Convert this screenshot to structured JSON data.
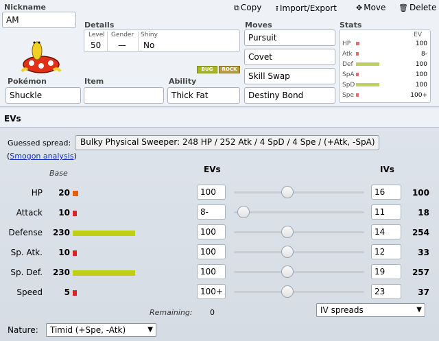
{
  "header": {
    "nickname_label": "Nickname",
    "nickname": "AM",
    "actions": [
      {
        "label": "Copy",
        "icon": "⧉"
      },
      {
        "label": "Import/Export",
        "icon": "⭱"
      },
      {
        "label": "Move",
        "icon": "✥"
      },
      {
        "label": "Delete",
        "icon": "🗑"
      }
    ]
  },
  "details": {
    "label": "Details",
    "level_label": "Level",
    "level": "50",
    "gender_label": "Gender",
    "gender": "—",
    "shiny_label": "Shiny",
    "shiny": "No"
  },
  "types": [
    "BUG",
    "ROCK"
  ],
  "pokemon": {
    "label": "Pokémon",
    "value": "Shuckle"
  },
  "item": {
    "label": "Item",
    "value": ""
  },
  "ability": {
    "label": "Ability",
    "value": "Thick Fat"
  },
  "moves": {
    "label": "Moves",
    "list": [
      "Pursuit",
      "Covet",
      "Skill Swap",
      "Destiny Bond"
    ]
  },
  "stats": {
    "label": "Stats",
    "ev_label": "EV",
    "rows": [
      {
        "name": "HP",
        "ev": "100",
        "color": "#e07070",
        "bar": 0.06
      },
      {
        "name": "Atk",
        "ev": "8-",
        "color": "#e07070",
        "bar": 0.03
      },
      {
        "name": "Def",
        "ev": "100",
        "color": "#c0d060",
        "bar": 0.45
      },
      {
        "name": "SpA",
        "ev": "100",
        "color": "#e07070",
        "bar": 0.03
      },
      {
        "name": "SpD",
        "ev": "100",
        "color": "#c0d060",
        "bar": 0.45
      },
      {
        "name": "Spe",
        "ev": "100+",
        "color": "#e07070",
        "bar": 0.03
      }
    ]
  },
  "evs": {
    "title": "EVs",
    "guessed_label": "Guessed spread:",
    "guessed": "Bulky Physical Sweeper: 248 HP / 252 Atk / 4 SpD / 4 Spe / (+Atk, -SpA)",
    "smogon_open": "(",
    "smogon_link": "Smogon analysis",
    "smogon_close": ")",
    "base_header": "Base",
    "evs_header": "EVs",
    "ivs_header": "IVs",
    "rows": [
      {
        "name": "HP",
        "base": "20",
        "bar_color": "#e06010",
        "bar_frac": 0.087,
        "ev": "100",
        "slider": 0.4,
        "iv": "16",
        "total": "100"
      },
      {
        "name": "Attack",
        "base": "10",
        "bar_color": "#e02020",
        "bar_frac": 0.043,
        "ev": "8-",
        "slider": 0.03,
        "iv": "11",
        "total": "18"
      },
      {
        "name": "Defense",
        "base": "230",
        "bar_color": "#c0d010",
        "bar_frac": 1.0,
        "ev": "100",
        "slider": 0.4,
        "iv": "14",
        "total": "254"
      },
      {
        "name": "Sp. Atk.",
        "base": "10",
        "bar_color": "#e02020",
        "bar_frac": 0.043,
        "ev": "100",
        "slider": 0.4,
        "iv": "12",
        "total": "33"
      },
      {
        "name": "Sp. Def.",
        "base": "230",
        "bar_color": "#c0d010",
        "bar_frac": 1.0,
        "ev": "100",
        "slider": 0.4,
        "iv": "19",
        "total": "257"
      },
      {
        "name": "Speed",
        "base": "5",
        "bar_color": "#e02020",
        "bar_frac": 0.03,
        "ev": "100+",
        "slider": 0.4,
        "iv": "23",
        "total": "37"
      }
    ],
    "remaining_label": "Remaining:",
    "remaining": "0",
    "iv_spreads": "IV spreads",
    "nature_label": "Nature:",
    "nature": "Timid (+Spe, -Atk)"
  }
}
